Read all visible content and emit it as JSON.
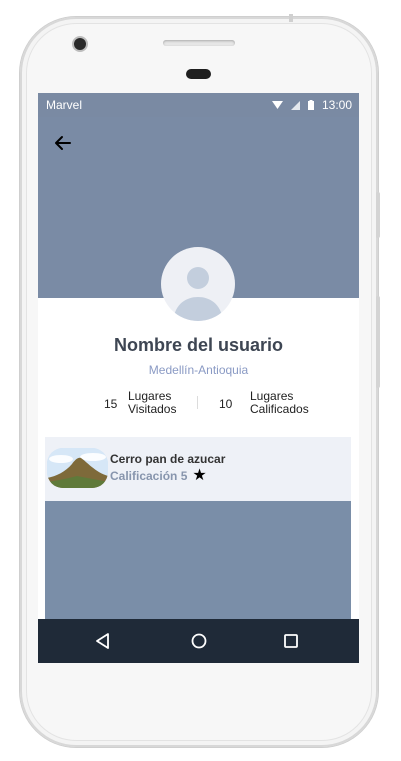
{
  "status_bar": {
    "carrier": "Marvel",
    "time": "13:00"
  },
  "profile": {
    "name": "Nombre del usuario",
    "location": "Medellín-Antioquia"
  },
  "stats": [
    {
      "value": "15",
      "label_line1": "Lugares",
      "label_line2": "Visitados"
    },
    {
      "value": "10",
      "label_line1": "Lugares",
      "label_line2": "Calificados"
    }
  ],
  "places": [
    {
      "title": "Cerro pan de azucar",
      "rating_text": "Calificación 5",
      "rating_icon": "star-icon"
    }
  ],
  "colors": {
    "header_bg": "#7a8ba5",
    "accent_text": "#8a9ac4",
    "nav_bg": "#1f2a38",
    "card_bg": "#eef1f7"
  }
}
